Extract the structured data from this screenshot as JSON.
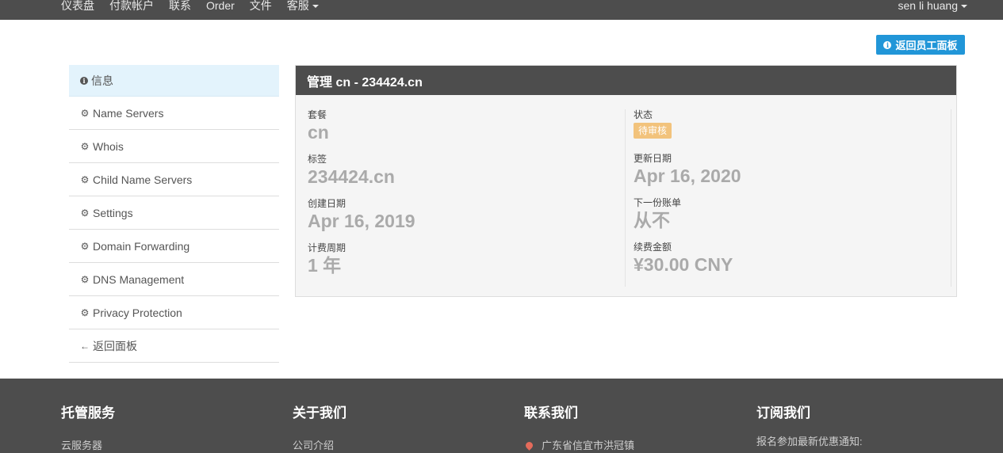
{
  "nav": {
    "links": [
      "仪表盘",
      "付款帐户",
      "联系",
      "Order",
      "文件",
      "客服"
    ],
    "user": "sen li huang"
  },
  "staff_button": "返回员工面板",
  "sidebar": {
    "items": [
      {
        "label": "信息",
        "icon": "info-icon",
        "active": true
      },
      {
        "label": "Name Servers",
        "icon": "gear-icon"
      },
      {
        "label": "Whois",
        "icon": "gear-icon"
      },
      {
        "label": "Child Name Servers",
        "icon": "gear-icon"
      },
      {
        "label": "Settings",
        "icon": "gear-icon"
      },
      {
        "label": "Domain Forwarding",
        "icon": "gear-icon"
      },
      {
        "label": "DNS Management",
        "icon": "gear-icon"
      },
      {
        "label": "Privacy Protection",
        "icon": "gear-icon"
      },
      {
        "label": "返回面板",
        "icon": "arrow-left-icon"
      }
    ]
  },
  "panel": {
    "title": "管理 cn - 234424.cn",
    "left": [
      {
        "label": "套餐",
        "value": "cn"
      },
      {
        "label": "标签",
        "value": "234424.cn"
      },
      {
        "label": "创建日期",
        "value": "Apr 16, 2019"
      },
      {
        "label": "计费周期",
        "value": "1 年"
      }
    ],
    "status_label": "状态",
    "status_badge": "待审核",
    "status_color": "#f2c37c",
    "right": [
      {
        "label": "更新日期",
        "value": "Apr 16, 2020"
      },
      {
        "label": "下一份账单",
        "value": "从不"
      },
      {
        "label": "续费金额",
        "value": "¥30.00 CNY"
      }
    ]
  },
  "footer": {
    "columns": [
      {
        "heading": "托管服务",
        "item": "云服务器"
      },
      {
        "heading": "关于我们",
        "item": "公司介绍"
      },
      {
        "heading": "联系我们",
        "item": "广东省信宜市洪冠镇"
      },
      {
        "heading": "订阅我们",
        "item": "报名参加最新优惠通知:"
      }
    ]
  },
  "colors": {
    "nav_bg": "#4d4d4d",
    "accent": "#2196d8",
    "active_bg": "#e3f3fc"
  }
}
